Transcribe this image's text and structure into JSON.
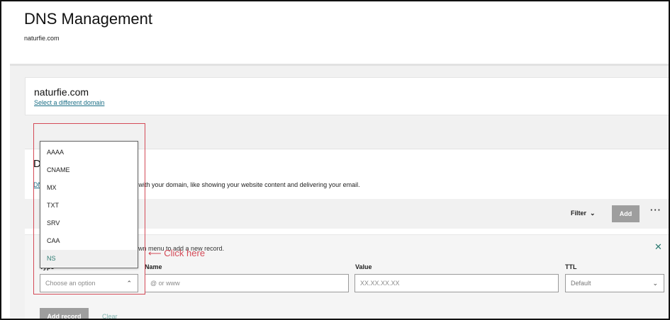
{
  "page": {
    "title": "DNS Management",
    "subtitle": "naturfie.com"
  },
  "domain_card": {
    "name": "naturfie.com",
    "change_link": "Select a different domain"
  },
  "records": {
    "heading": "D",
    "desc_link": "DN",
    "description": "o with your domain, like showing your website content and delivering your email.",
    "toolbar": {
      "filter_label": "Filter",
      "add_label": "Add",
      "more_label": "···"
    },
    "form": {
      "hint": "down menu to add a new record.",
      "close_label": "✕",
      "type_label": "Type",
      "name_label": "Name",
      "value_label": "Value",
      "ttl_label": "TTL",
      "type_placeholder": "Choose an option",
      "name_placeholder": "@ or www",
      "value_placeholder": "XX.XX.XX.XX",
      "ttl_value": "Default",
      "add_record_label": "Add record",
      "clear_label": "Clear"
    }
  },
  "dropdown": {
    "options": [
      "AAAA",
      "CNAME",
      "MX",
      "TXT",
      "SRV",
      "CAA",
      "NS"
    ],
    "highlighted": "NS"
  },
  "annotation": {
    "text": "Click here",
    "color": "#d44a57"
  },
  "colors": {
    "accent": "#2b7a70",
    "link": "#1a6e85",
    "button_gray": "#9e9e9e"
  }
}
